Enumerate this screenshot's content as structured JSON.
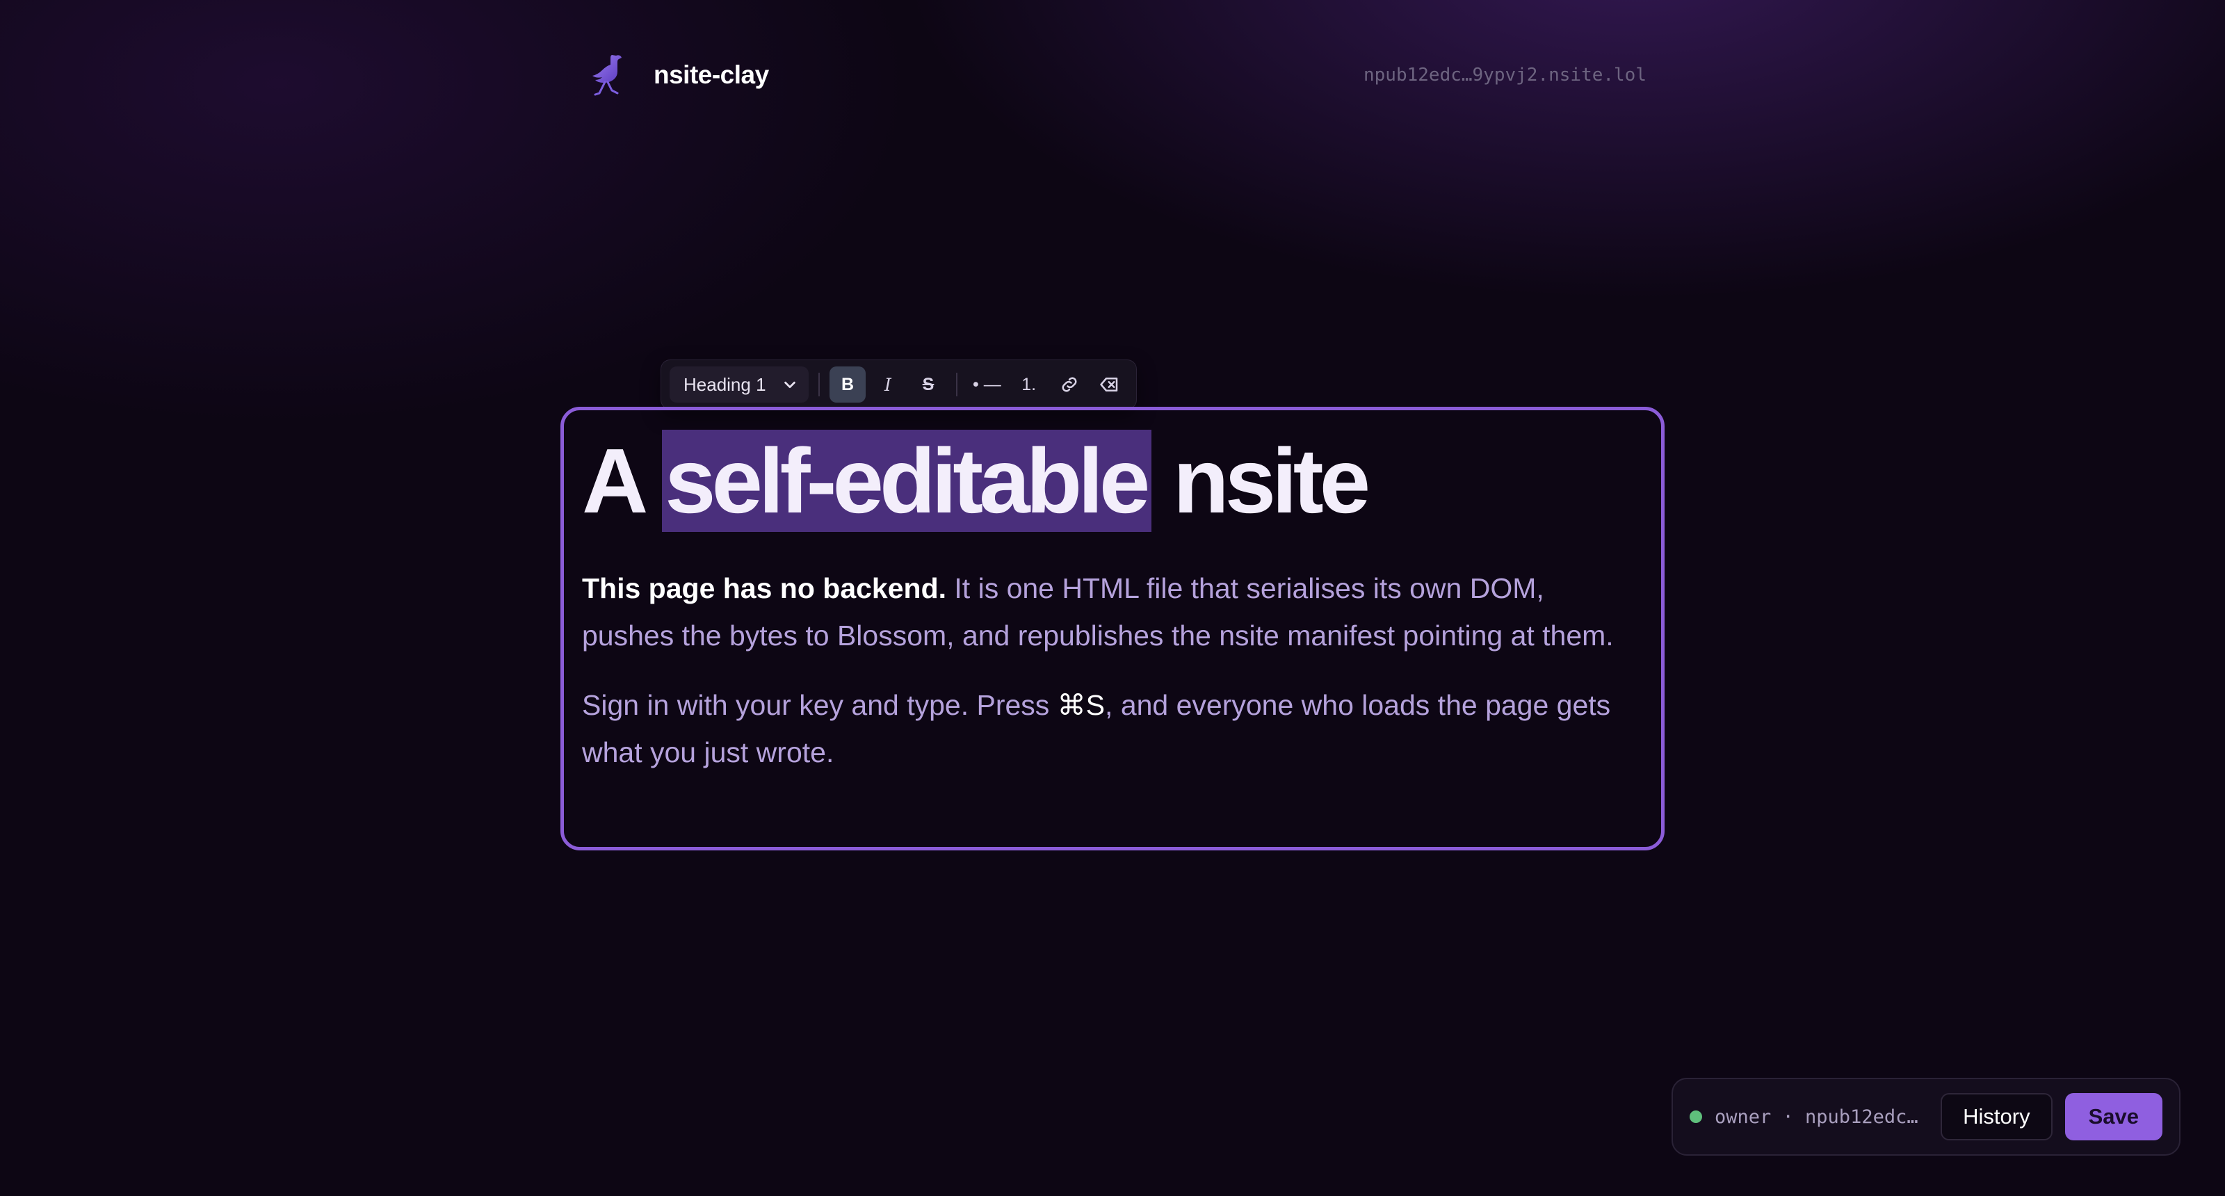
{
  "header": {
    "brand_name": "nsite-clay",
    "logo_icon": "ostrich-icon",
    "npub_link": "npub12edc…9ypvj2.nsite.lol"
  },
  "toolbar": {
    "block_type": "Heading 1",
    "bold": "B",
    "italic": "I",
    "strike": "S",
    "bullet_list": "• —",
    "ordered_list": "1.",
    "link_icon": "link-icon",
    "clear_format_icon": "clear-format-icon"
  },
  "content": {
    "heading_before": "A ",
    "heading_highlight": "self-editable",
    "heading_after": " nsite",
    "p1_bold": "This page has no backend.",
    "p1_rest": " It is one HTML file that serialises its own DOM, pushes the bytes to Blossom, and republishes the nsite manifest pointing at them.",
    "p2_before": "Sign in with your key and type. Press ",
    "p2_shortcut": "⌘S",
    "p2_after": ", and everyone who loads the page gets what you just wrote."
  },
  "status": {
    "owner_label": "owner · npub12edc…",
    "history_label": "History",
    "save_label": "Save",
    "online_color": "#5fbf7c"
  },
  "colors": {
    "accent": "#8b5cd8",
    "save_button": "#8f5fe0",
    "selection": "#4a2f7c",
    "background": "#0d0614"
  }
}
